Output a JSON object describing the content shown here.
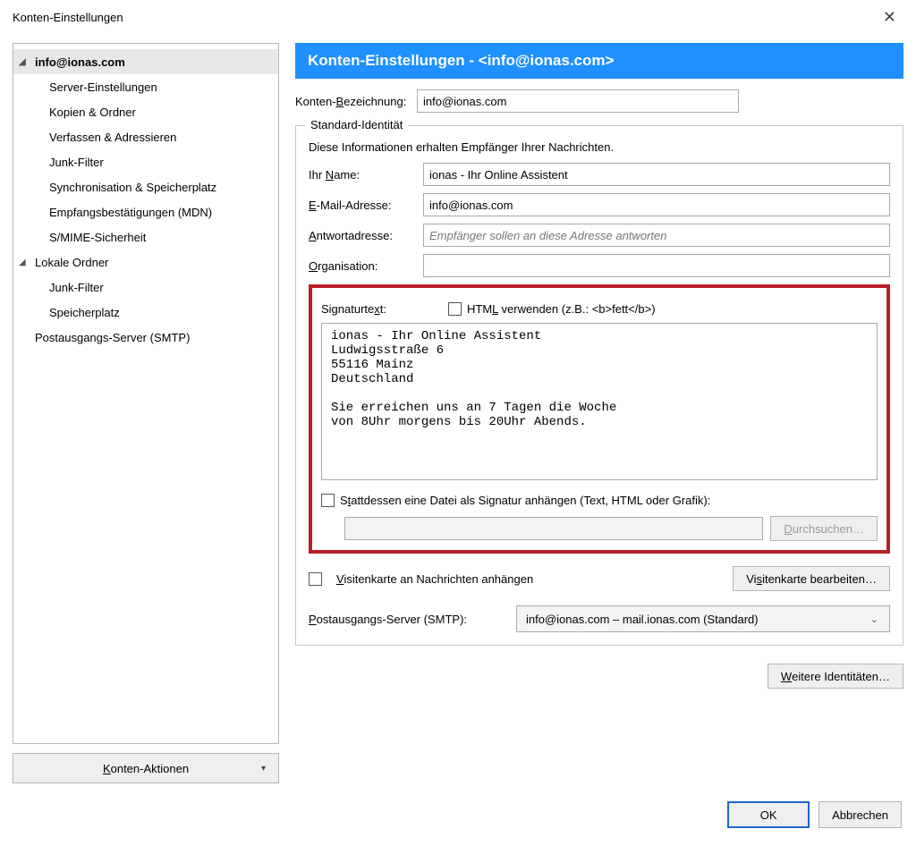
{
  "window": {
    "title": "Konten-Einstellungen"
  },
  "tree": {
    "items": [
      {
        "label": "info@ionas.com",
        "level": 1,
        "expanded": true,
        "selected": true
      },
      {
        "label": "Server-Einstellungen",
        "level": 2
      },
      {
        "label": "Kopien & Ordner",
        "level": 2
      },
      {
        "label": "Verfassen & Adressieren",
        "level": 2
      },
      {
        "label": "Junk-Filter",
        "level": 2
      },
      {
        "label": "Synchronisation & Speicherplatz",
        "level": 2
      },
      {
        "label": "Empfangsbestätigungen (MDN)",
        "level": 2
      },
      {
        "label": "S/MIME-Sicherheit",
        "level": 2
      },
      {
        "label": "Lokale Ordner",
        "level": 1,
        "expanded": true
      },
      {
        "label": "Junk-Filter",
        "level": 2
      },
      {
        "label": "Speicherplatz",
        "level": 2
      },
      {
        "label": "Postausgangs-Server (SMTP)",
        "level": 1
      }
    ],
    "actions_label": "Konten-Aktionen"
  },
  "panel": {
    "banner": "Konten-Einstellungen -  <info@ionas.com>",
    "account_name_label": "Konten-Bezeichnung:",
    "account_name_value": "info@ionas.com",
    "identity_legend": "Standard-Identität",
    "identity_help": "Diese Informationen erhalten Empfänger Ihrer Nachrichten.",
    "name_label": "Ihr Name:",
    "name_value": "ionas - Ihr Online Assistent",
    "email_label": "E-Mail-Adresse:",
    "email_value": "info@ionas.com",
    "replyto_label": "Antwortadresse:",
    "replyto_placeholder": "Empfänger sollen an diese Adresse antworten",
    "org_label": "Organisation:",
    "org_value": "",
    "sig_label": "Signaturtext:",
    "html_checkbox_label": "HTML verwenden (z.B.: <b>fett</b>)",
    "signature_text": "ionas - Ihr Online Assistent\nLudwigsstraße 6\n55116 Mainz\nDeutschland\n\nSie erreichen uns an 7 Tagen die Woche\nvon 8Uhr morgens bis 20Uhr Abends.",
    "sig_file_label": "Stattdessen eine Datei als Signatur anhängen (Text, HTML oder Grafik):",
    "browse_label": "Durchsuchen…",
    "vcard_label": "Visitenkarte an Nachrichten anhängen",
    "vcard_edit_label": "Visitenkarte bearbeiten…",
    "smtp_label": "Postausgangs-Server (SMTP):",
    "smtp_value": "info@ionas.com – mail.ionas.com (Standard)",
    "more_identities_label": "Weitere Identitäten…"
  },
  "footer": {
    "ok": "OK",
    "cancel": "Abbrechen"
  }
}
